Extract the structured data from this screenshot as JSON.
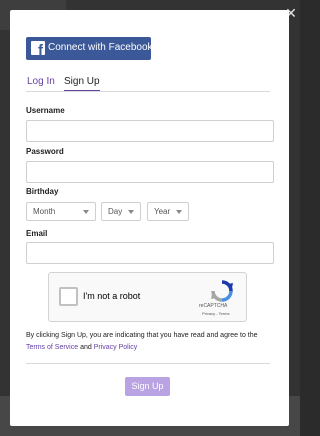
{
  "close_icon_glyph": "✕",
  "facebook": {
    "label": "Connect with Facebook",
    "icon": "f",
    "color": "#3b5998"
  },
  "tabs": [
    {
      "label": "Log In",
      "active": false
    },
    {
      "label": "Sign Up",
      "active": true
    }
  ],
  "accent_color": "#6441a5",
  "form": {
    "username_label": "Username",
    "username_value": "",
    "password_label": "Password",
    "password_value": "",
    "birthday_label": "Birthday",
    "birthday": {
      "month": "Month",
      "day": "Day",
      "year": "Year"
    },
    "email_label": "Email",
    "email_value": ""
  },
  "captcha": {
    "checkbox_label": "I'm not a robot",
    "brand": "reCAPTCHA",
    "links": "Privacy - Terms",
    "checked": false
  },
  "legal": {
    "text_before": "By clicking Sign Up, you are indicating that you have read and agree to the",
    "terms": "Terms of Service",
    "and": "and",
    "privacy": "Privacy Policy"
  },
  "submit_label": "Sign Up",
  "submit_color": "#b9a3e3"
}
